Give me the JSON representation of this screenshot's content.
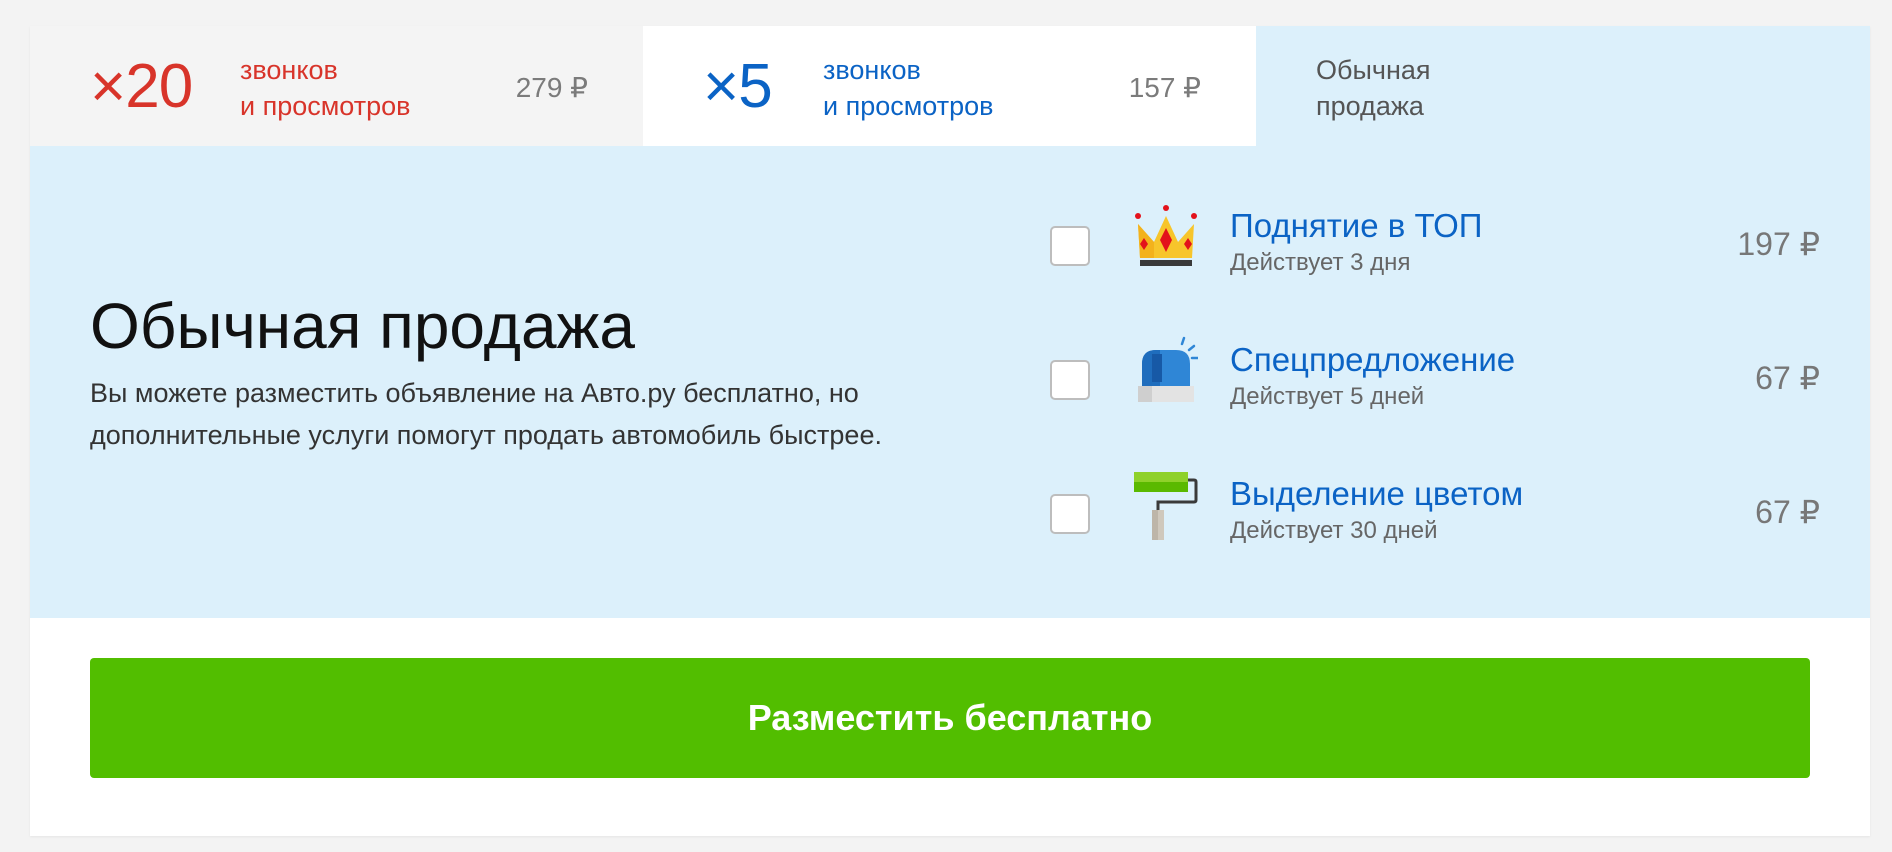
{
  "tabs": [
    {
      "multiplier": "×20",
      "line1": "звонков",
      "line2": "и просмотров",
      "price": "279 ₽"
    },
    {
      "multiplier": "×5",
      "line1": "звонков",
      "line2": "и просмотров",
      "price": "157 ₽"
    },
    {
      "line1": "Обычная",
      "line2": "продажа"
    }
  ],
  "main": {
    "title": "Обычная продажа",
    "description": "Вы можете разместить объявление на Авто.ру бесплатно, но дополнительные услуги помогут продать автомобиль быстрее."
  },
  "services": [
    {
      "title": "Поднятие в ТОП",
      "subtitle": "Действует 3 дня",
      "price": "197 ₽",
      "icon": "crown-icon"
    },
    {
      "title": "Спецпредложение",
      "subtitle": "Действует 5 дней",
      "price": "67 ₽",
      "icon": "beacon-icon"
    },
    {
      "title": "Выделение цветом",
      "subtitle": "Действует 30 дней",
      "price": "67 ₽",
      "icon": "paint-roller-icon"
    }
  ],
  "cta": {
    "label": "Разместить бесплатно"
  },
  "colors": {
    "x20_accent": "#d8342a",
    "x5_accent": "#0b63c5",
    "panel_bg": "#dcf0fb",
    "cta_bg": "#52be00",
    "link": "#0b63c5"
  }
}
